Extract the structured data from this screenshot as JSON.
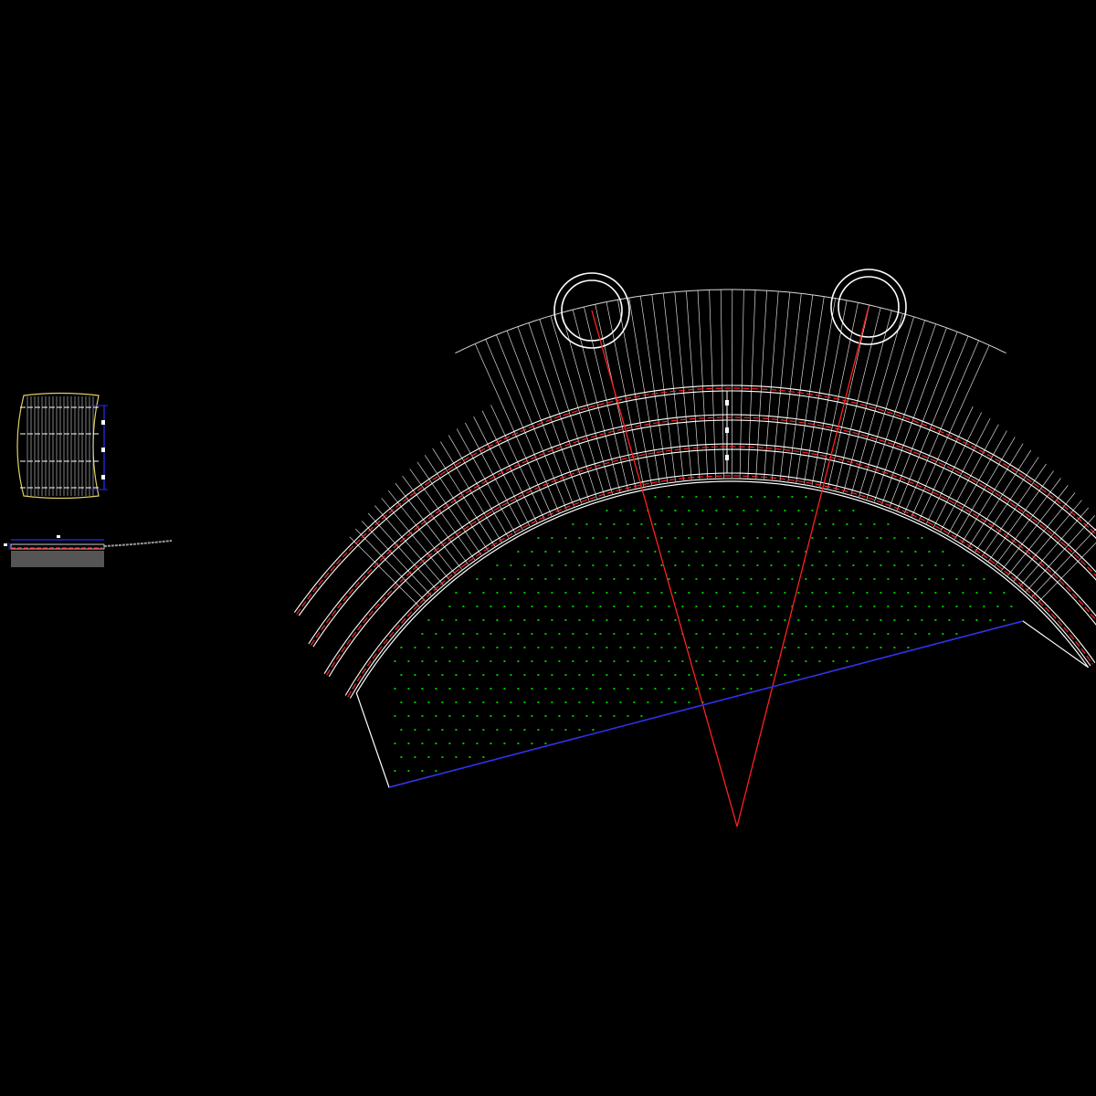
{
  "drawing": {
    "background": "#000000",
    "colors": {
      "line": "#ffffff",
      "thin_line": "#d8d8d8",
      "red": "#ff2020",
      "blue": "#2a2aff",
      "green": "#00c000",
      "yellow": "#e0d060",
      "gray": "#9a9a9a"
    },
    "layers": [
      "radial-paving-lines",
      "ring-paths",
      "lawn-sector",
      "tree-circles",
      "axis-lines",
      "chord-line",
      "detail-plan",
      "detail-section"
    ]
  }
}
